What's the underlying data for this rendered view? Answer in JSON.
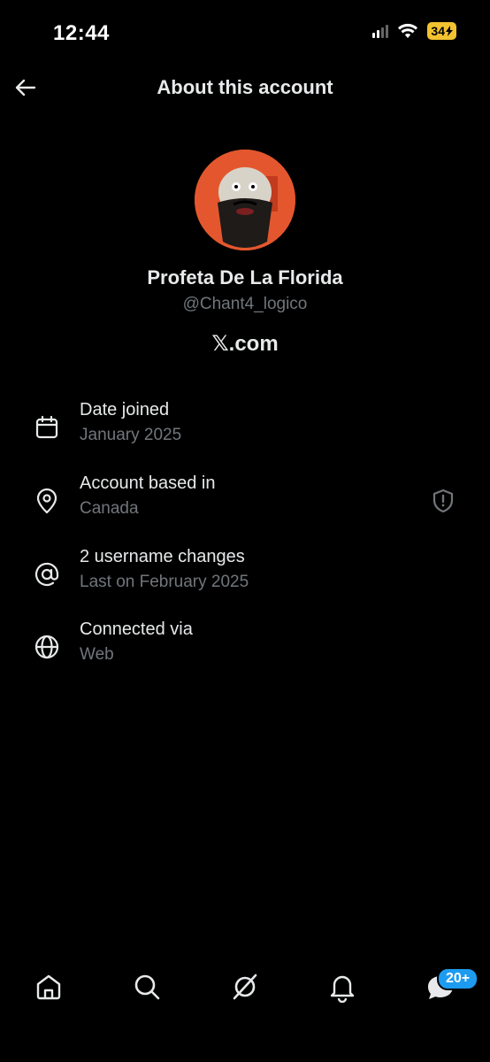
{
  "status_bar": {
    "time": "12:44",
    "battery": "34"
  },
  "header": {
    "title": "About this account"
  },
  "profile": {
    "display_name": "Profeta De La Florida",
    "handle": "@Chant4_logico",
    "site": "𝕏.com"
  },
  "info": [
    {
      "icon": "calendar-icon",
      "title": "Date joined",
      "value": "January 2025"
    },
    {
      "icon": "location-pin-icon",
      "title": "Account based in",
      "value": "Canada"
    },
    {
      "icon": "at-sign-icon",
      "title": "2 username changes",
      "value": "Last on February 2025"
    },
    {
      "icon": "globe-icon",
      "title": "Connected via",
      "value": "Web"
    }
  ],
  "bottom_nav": {
    "items": [
      "home-icon",
      "search-icon",
      "grok-icon",
      "notifications-icon",
      "messages-icon"
    ],
    "messages_badge": "20+"
  },
  "colors": {
    "background": "#000000",
    "text": "#e7e9ea",
    "secondary": "#71767b",
    "badge": "#1d9bf0",
    "battery": "#f2c230"
  }
}
